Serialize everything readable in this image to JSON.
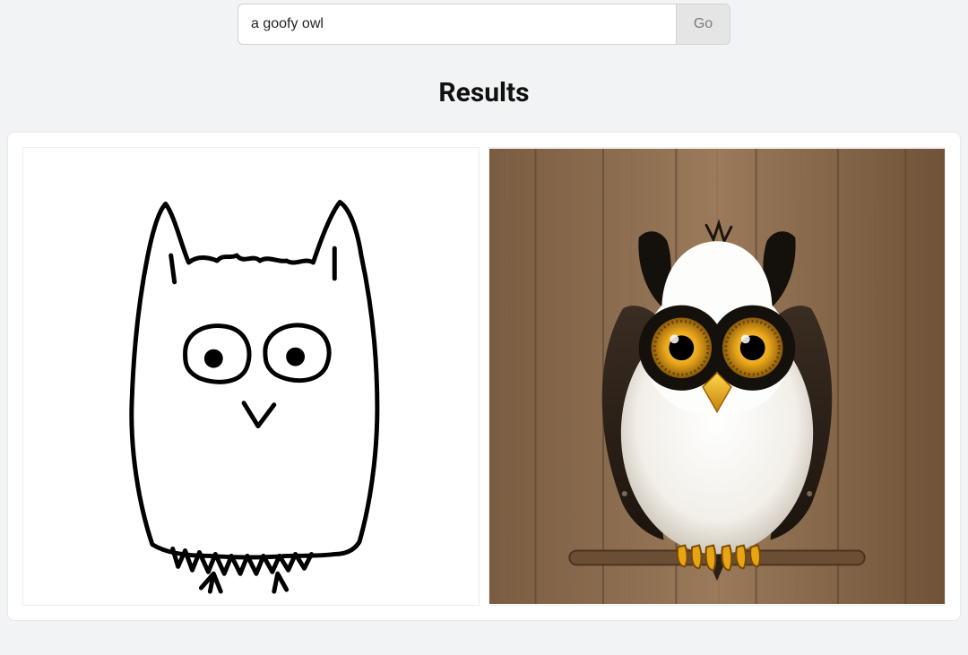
{
  "search": {
    "query": "a goofy owl",
    "go_label": "Go"
  },
  "results": {
    "title": "Results",
    "left_alt": "sketch-input-owl",
    "right_alt": "generated-output-owl"
  }
}
